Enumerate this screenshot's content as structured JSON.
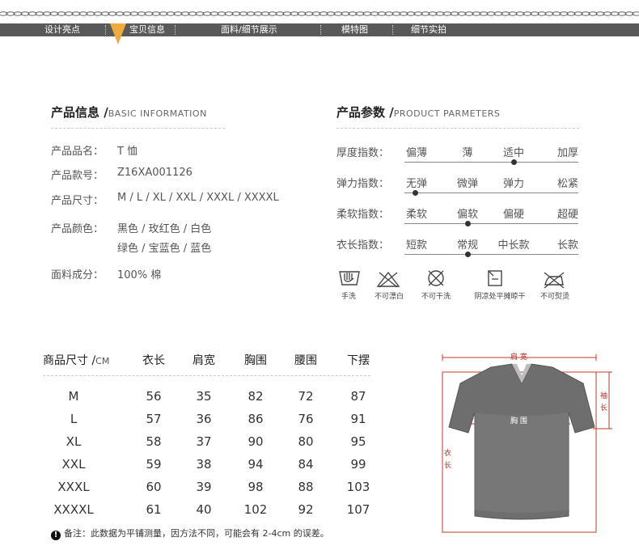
{
  "nav": {
    "items": [
      "设计亮点",
      "宝贝信息",
      "面料/细节展示",
      "模特图",
      "细节实拍"
    ]
  },
  "info": {
    "title": "产品信息 /",
    "subtitle": "BASIC INFORMATION",
    "rows": [
      {
        "label": "产品品名：",
        "value": "T 恤"
      },
      {
        "label": "产品款号：",
        "value": "Z16XA001126"
      },
      {
        "label": "产品尺寸：",
        "value": "M / L / XL / XXL / XXXL / XXXXL"
      },
      {
        "label": "产品颜色：",
        "value": "黑色 / 玫红色 / 白色",
        "value2": "绿色 / 宝蓝色 / 蓝色"
      },
      {
        "label": "面料成分：",
        "value": "100% 棉"
      }
    ]
  },
  "params": {
    "title": "产品参数 /",
    "subtitle": "PRODUCT PARMETERS",
    "rows": [
      {
        "label": "厚度指数：",
        "options": [
          "偏薄",
          "薄",
          "适中",
          "加厚"
        ],
        "selected": 2
      },
      {
        "label": "弹力指数：",
        "options": [
          "无弹",
          "微弹",
          "弹力",
          "松紧"
        ],
        "selected": 0
      },
      {
        "label": "柔软指数：",
        "options": [
          "柔软",
          "偏软",
          "偏硬",
          "超硬"
        ],
        "selected": 1
      },
      {
        "label": "衣长指数：",
        "options": [
          "短款",
          "常规",
          "中长款",
          "长款"
        ],
        "selected": 1
      }
    ]
  },
  "care": [
    "手洗",
    "不可漂白",
    "不可干洗",
    "阴凉处平摊晾干",
    "不可熨烫"
  ],
  "size_table": {
    "header_title": "商品尺寸 /",
    "header_unit": "CM",
    "columns": [
      "衣长",
      "肩宽",
      "胸围",
      "腰围",
      "下摆"
    ],
    "rows": [
      {
        "size": "M",
        "values": [
          "56",
          "35",
          "82",
          "72",
          "87"
        ]
      },
      {
        "size": "L",
        "values": [
          "57",
          "36",
          "86",
          "76",
          "91"
        ]
      },
      {
        "size": "XL",
        "values": [
          "58",
          "37",
          "90",
          "80",
          "95"
        ]
      },
      {
        "size": "XXL",
        "values": [
          "59",
          "38",
          "94",
          "84",
          "99"
        ]
      },
      {
        "size": "XXXL",
        "values": [
          "60",
          "39",
          "98",
          "88",
          "103"
        ]
      },
      {
        "size": "XXXXL",
        "values": [
          "61",
          "40",
          "102",
          "92",
          "107"
        ]
      }
    ],
    "note": "备注：此数据为平铺测量，因方法不同，可能会有 2-4cm 的误差。",
    "note_icon": "!"
  },
  "diagram": {
    "shoulder": "肩 宽",
    "chest": "胸 围",
    "sleeve1": "袖",
    "sleeve2": "长",
    "length1": "衣",
    "length2": "长"
  },
  "colors": {
    "navbar": "#58595b",
    "marker": "#f0ab3c",
    "measure": "#c0392b",
    "shirt": "#6e6e6e"
  }
}
